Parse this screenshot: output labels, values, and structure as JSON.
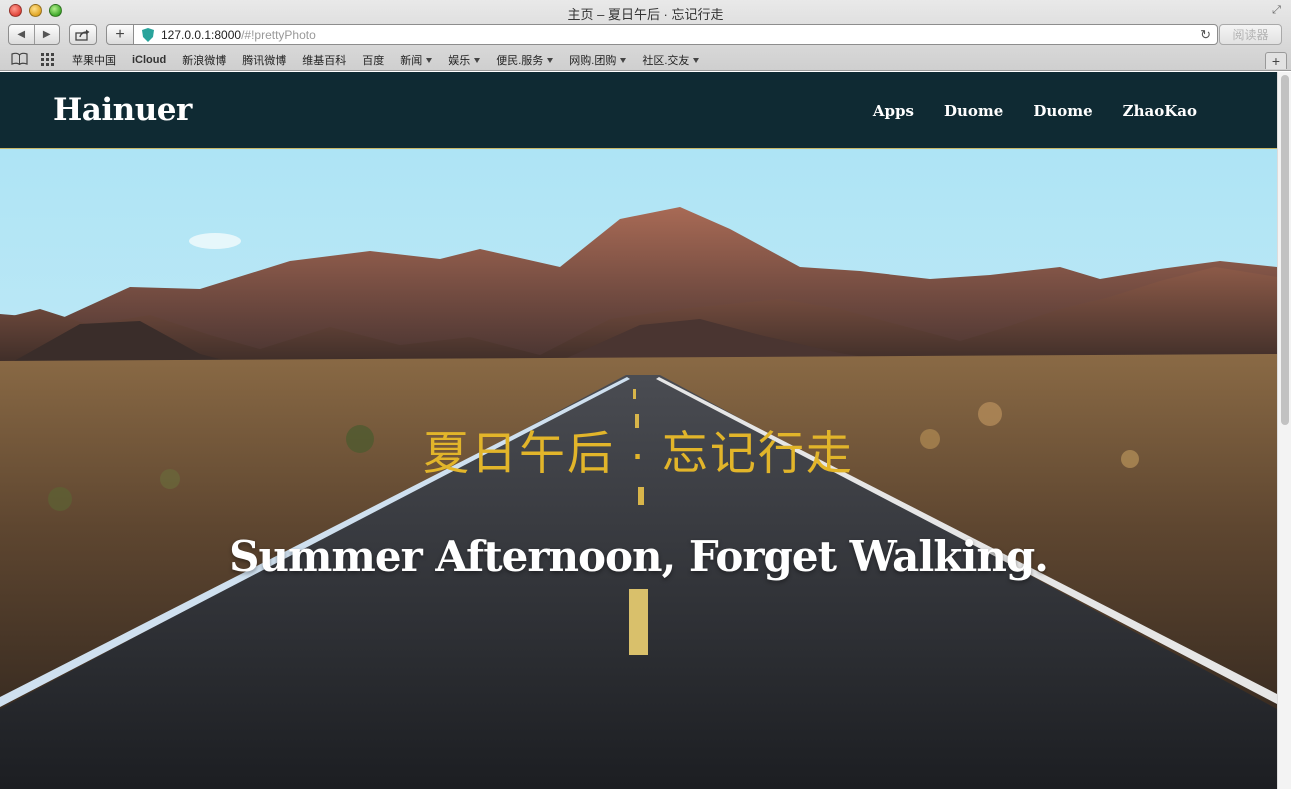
{
  "window": {
    "title": "主页 – 夏日午后 · 忘记行走"
  },
  "toolbar": {
    "back_icon": "back-arrow-icon",
    "forward_icon": "forward-arrow-icon",
    "share_icon": "share-icon",
    "add_label": "+",
    "url_host": "127.0.0.1:8000",
    "url_path": "/#!prettyPhoto",
    "reader_label": "阅读器"
  },
  "bookmarks": {
    "items": [
      {
        "label": "苹果中国",
        "has_menu": false
      },
      {
        "label": "iCloud",
        "has_menu": false,
        "bold": true
      },
      {
        "label": "新浪微博",
        "has_menu": false
      },
      {
        "label": "腾讯微博",
        "has_menu": false
      },
      {
        "label": "维基百科",
        "has_menu": false
      },
      {
        "label": "百度",
        "has_menu": false
      },
      {
        "label": "新闻",
        "has_menu": true
      },
      {
        "label": "娱乐",
        "has_menu": true
      },
      {
        "label": "便民.服务",
        "has_menu": true
      },
      {
        "label": "网购.团购",
        "has_menu": true
      },
      {
        "label": "社区.交友",
        "has_menu": true
      }
    ]
  },
  "site": {
    "brand": "Hainuer",
    "nav": [
      "Apps",
      "Duome",
      "Duome",
      "ZhaoKao"
    ],
    "colors": {
      "navbar_bg": "#0f2a33",
      "cn_title": "#e2b52a",
      "en_title": "#ffffff"
    }
  },
  "hero": {
    "title_cn": "夏日午后 · 忘记行走",
    "title_en": "Summer Afternoon, Forget Walking."
  }
}
